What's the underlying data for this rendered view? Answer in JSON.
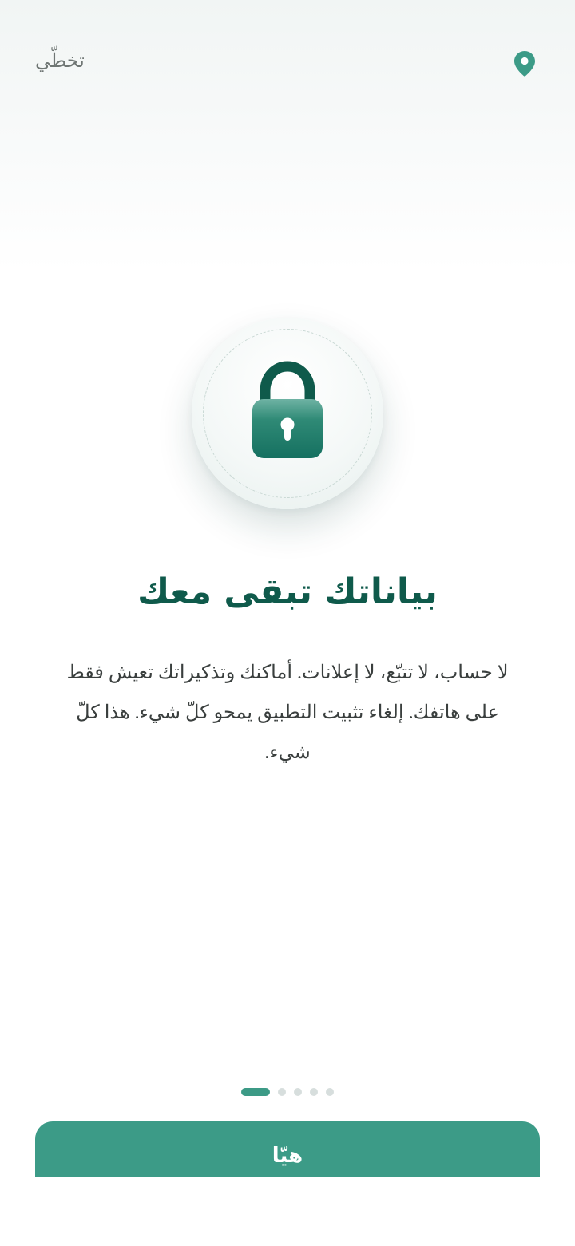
{
  "header": {
    "skip_label": "تخطّي",
    "location_icon": "map-pin-icon"
  },
  "hero": {
    "icon": "lock-icon"
  },
  "onboarding": {
    "title": "بياناتك تبقى معك",
    "description": "لا حساب، لا تتبّع، لا إعلانات. أماكنك وتذكيراتك تعيش فقط على هاتفك. إلغاء تثبيت التطبيق يمحو كلّ شيء. هذا كلّ شيء."
  },
  "pager": {
    "total_pages": 5,
    "current_page": 1
  },
  "cta": {
    "label": "هيّا"
  },
  "colors": {
    "accent": "#3c9b87",
    "title": "#0f5a4b",
    "body_text": "#3a3f3e",
    "muted_text": "#6f7674",
    "dot_inactive": "#d7dedd"
  }
}
